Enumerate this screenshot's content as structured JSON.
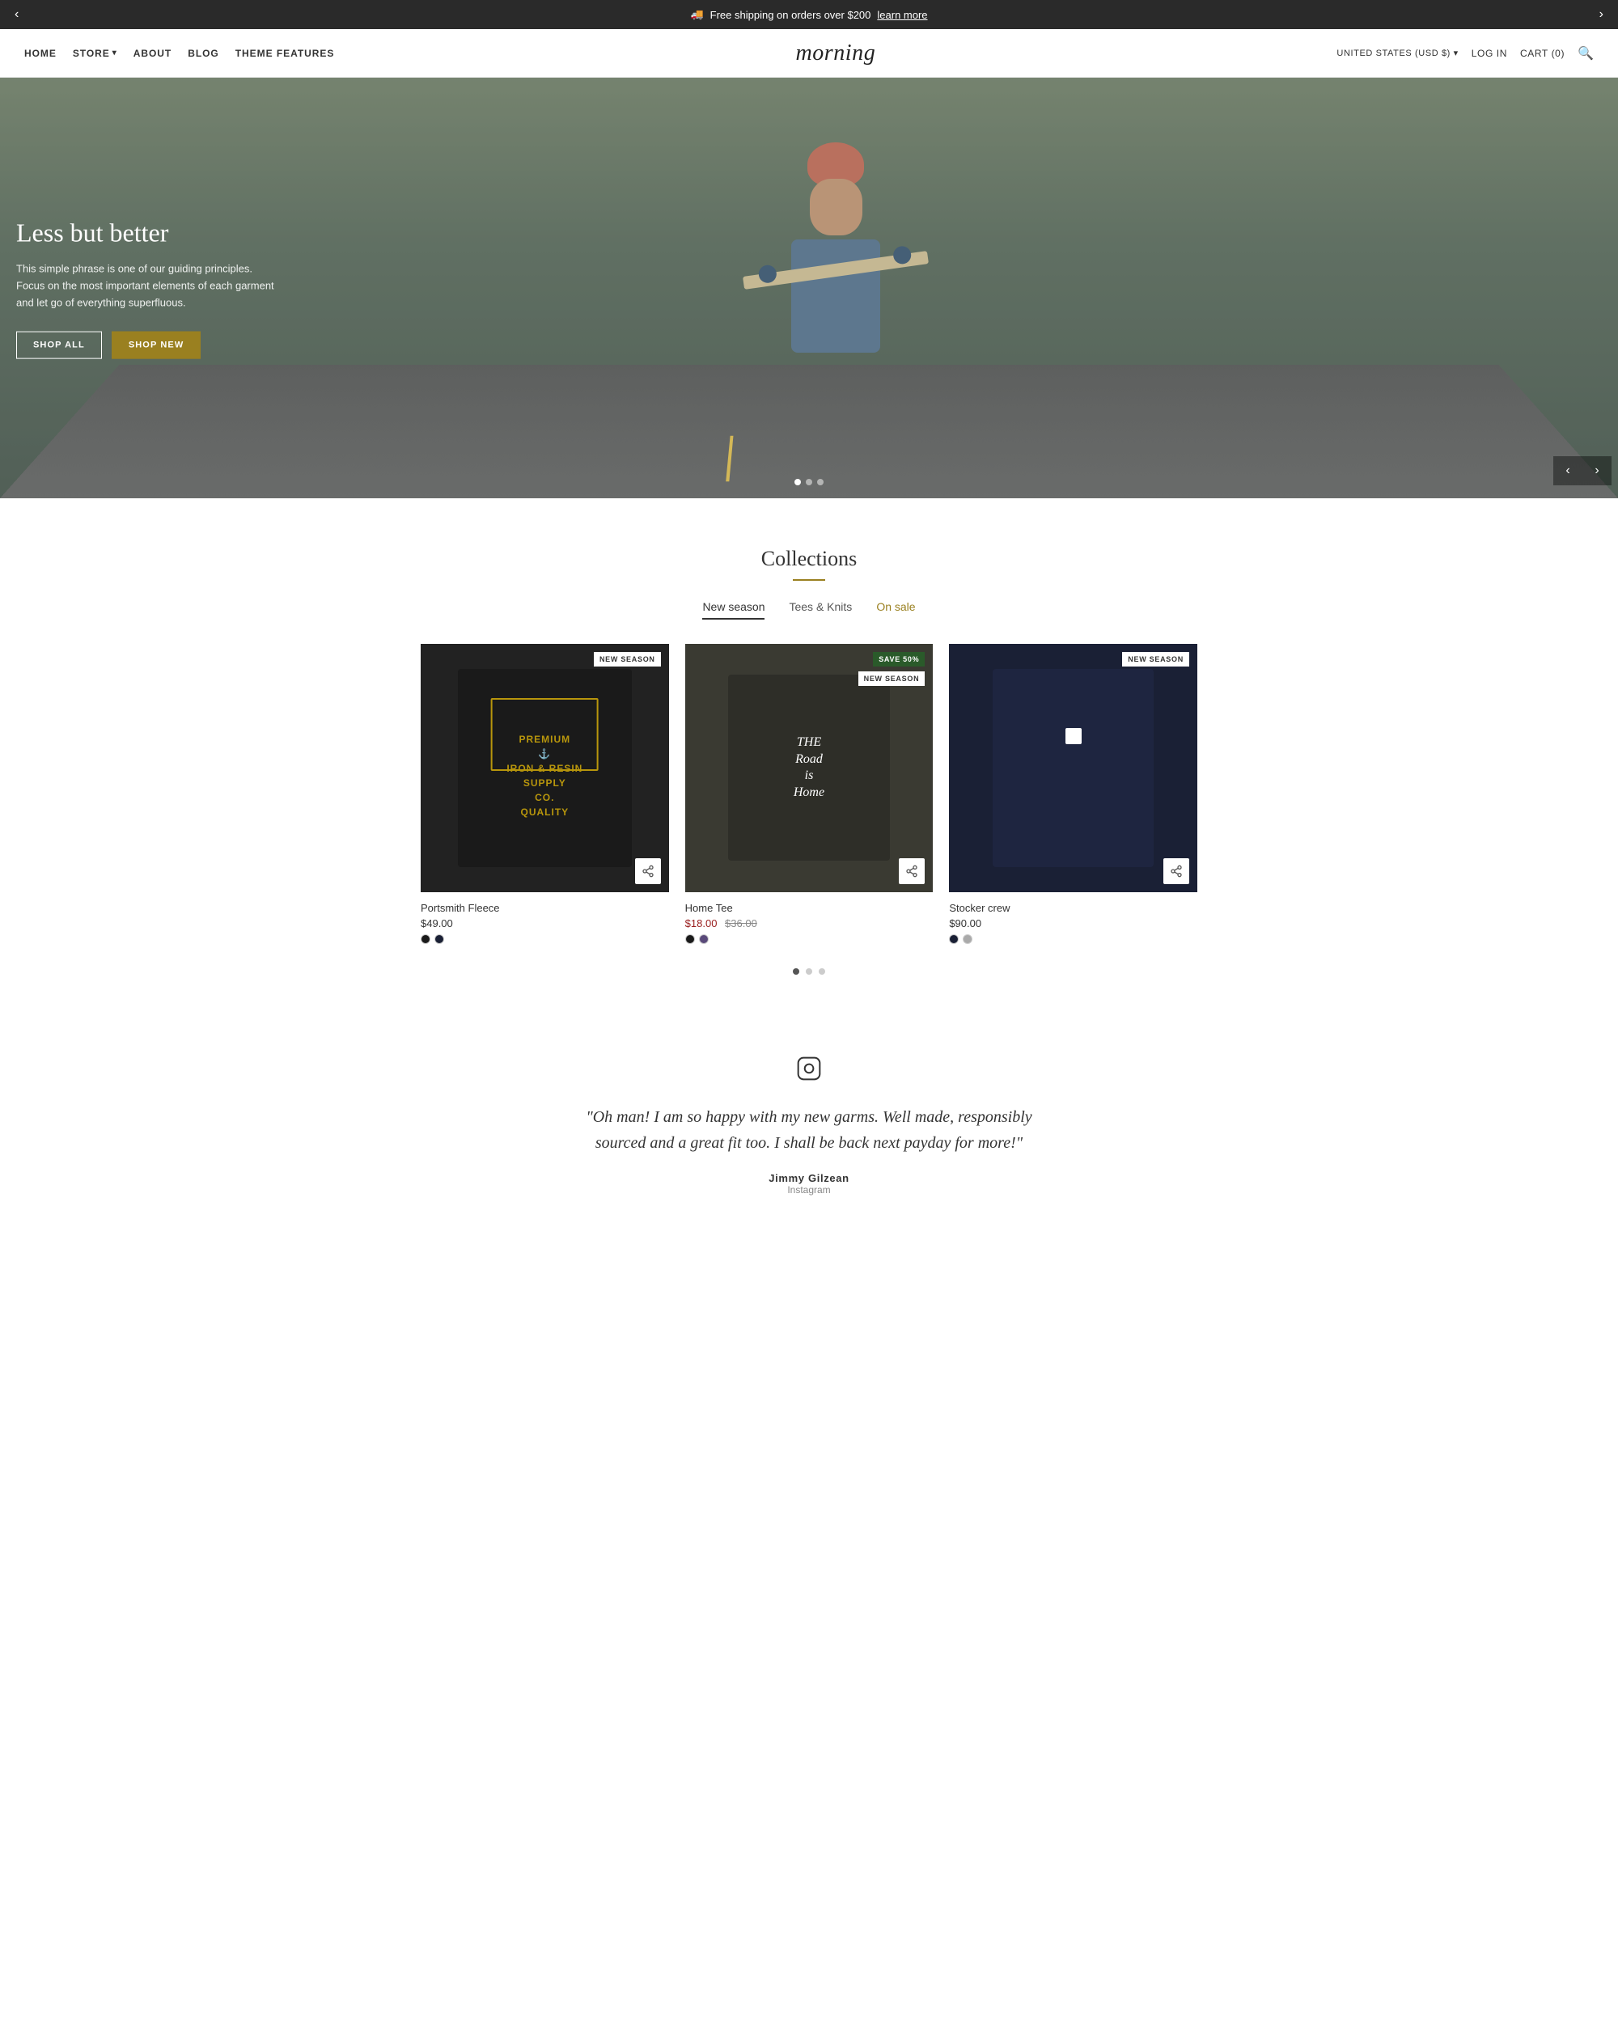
{
  "announcement": {
    "text": "Free shipping on orders over $200",
    "link_text": "learn more",
    "truck_icon": "🚚"
  },
  "nav": {
    "left_links": [
      {
        "label": "HOME",
        "id": "home"
      },
      {
        "label": "STORE",
        "id": "store",
        "has_dropdown": true
      },
      {
        "label": "ABOUT",
        "id": "about"
      },
      {
        "label": "BLOG",
        "id": "blog"
      },
      {
        "label": "THEME FEATURES",
        "id": "theme-features"
      }
    ],
    "logo": "morning",
    "right_links": [
      {
        "label": "UNITED STATES (USD $)",
        "id": "region",
        "has_dropdown": true
      },
      {
        "label": "LOG IN",
        "id": "login"
      },
      {
        "label": "CART (0)",
        "id": "cart"
      }
    ],
    "search_icon": "🔍"
  },
  "hero": {
    "headline": "Less but better",
    "body": "This simple phrase is one of our guiding principles. Focus on the most important elements of each garment and let go of everything superfluous.",
    "btn_all": "SHOP ALL",
    "btn_new": "SHOP NEW",
    "dots": [
      {
        "active": true
      },
      {
        "active": false
      },
      {
        "active": false
      }
    ]
  },
  "collections": {
    "title": "Collections",
    "tabs": [
      {
        "label": "New season",
        "active": true,
        "sale": false
      },
      {
        "label": "Tees & Knits",
        "active": false,
        "sale": false
      },
      {
        "label": "On sale",
        "active": false,
        "sale": true
      }
    ],
    "products": [
      {
        "name": "Portsmith Fleece",
        "price": "$49.00",
        "badge": "NEW SEASON",
        "badge_type": "new",
        "swatches": [
          "black",
          "navy"
        ],
        "image_type": "fleece"
      },
      {
        "name": "Home Tee",
        "price_sale": "$18.00",
        "price_original": "$36.00",
        "badge": "SAVE 50%",
        "badge2": "NEW SEASON",
        "badge_type": "save",
        "swatches": [
          "black",
          "purple"
        ],
        "image_type": "tee"
      },
      {
        "name": "Stocker crew",
        "price": "$90.00",
        "badge": "NEW SEASON",
        "badge_type": "new",
        "swatches": [
          "navy",
          "grey"
        ],
        "image_type": "crew"
      }
    ],
    "pagination": [
      {
        "active": true
      },
      {
        "active": false
      },
      {
        "active": false
      }
    ]
  },
  "testimonial": {
    "quote": "\"Oh man! I am so happy with my new garms. Well made, responsibly sourced and a great fit too. I shall be back next payday for more!\"",
    "author": "Jimmy Gilzean",
    "handle": "Instagram"
  }
}
